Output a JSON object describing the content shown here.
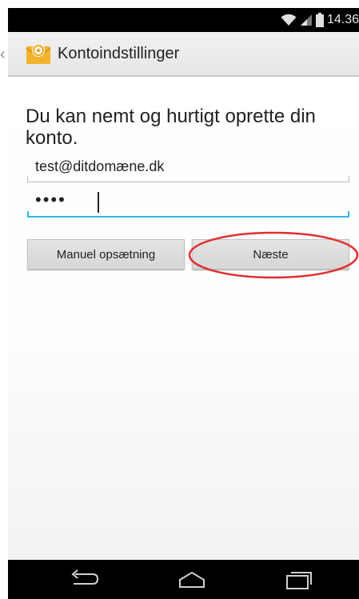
{
  "status_bar": {
    "time": "14.36",
    "icons": [
      "wifi-icon",
      "signal-icon",
      "battery-icon"
    ]
  },
  "action_bar": {
    "title": "Kontoindstillinger",
    "app_icon": "email-app-icon"
  },
  "form": {
    "intro": "Du kan nemt og hurtigt oprette din konto.",
    "email_value": "test@ditdomæne.dk",
    "password_value": "••••"
  },
  "buttons": {
    "manual_label": "Manuel opsætning",
    "next_label": "Næste"
  },
  "nav_bar": {
    "icons": [
      "back-icon",
      "home-icon",
      "recents-icon"
    ]
  },
  "colors": {
    "accent": "#33b5e5",
    "highlight": "#e03030",
    "bar_background": "#000000"
  }
}
